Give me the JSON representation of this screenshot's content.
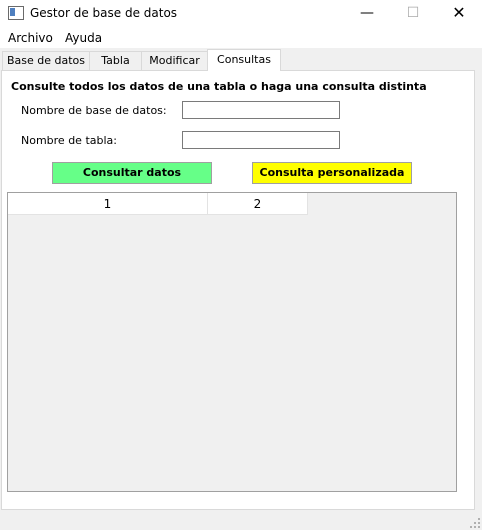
{
  "window": {
    "title": "Gestor de base de datos",
    "min_glyph": "—",
    "max_glyph": "☐",
    "close_glyph": "✕"
  },
  "menu": [
    "Archivo",
    "Ayuda"
  ],
  "tabs": [
    {
      "label": "Base de datos"
    },
    {
      "label": "Tabla"
    },
    {
      "label": "Modificar"
    },
    {
      "label": "Consultas",
      "active": true
    }
  ],
  "consultas": {
    "instruction": "Consulte todos los datos de una tabla o haga una consulta distinta",
    "db_name_label": "Nombre de  base de datos:",
    "db_name_value": "",
    "table_name_label": "Nombre de tabla:",
    "table_name_value": "",
    "consultar_button": "Consultar datos",
    "personalizada_button": "Consulta personalizada",
    "grid_headers": [
      "1",
      "2"
    ]
  },
  "colors": {
    "consultar_button_bg": "#66ff88",
    "personalizada_button_bg": "#ffff00",
    "window_bg": "#f0f0f0"
  }
}
